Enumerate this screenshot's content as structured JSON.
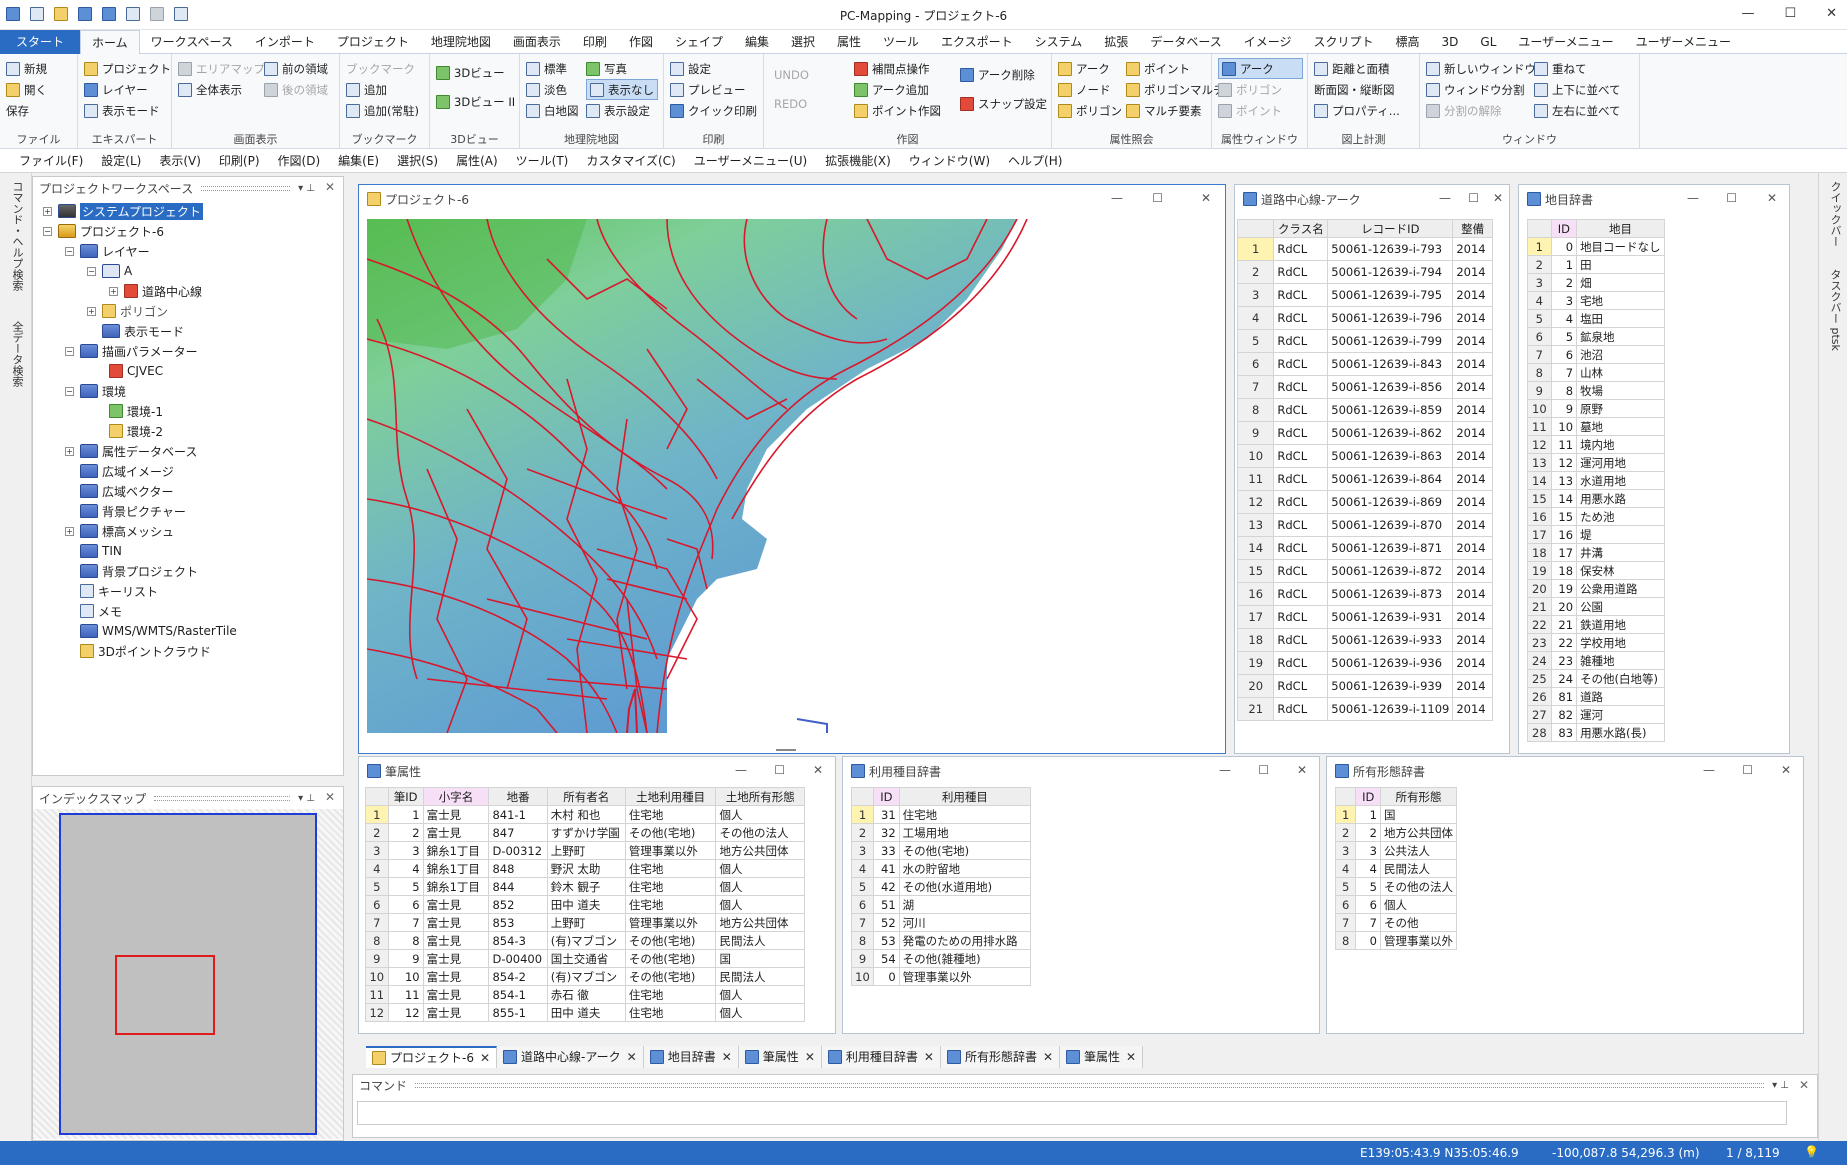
{
  "app": {
    "title": "PC-Mapping - プロジェクト-6"
  },
  "menu_tabs": [
    "スタート",
    "ホーム",
    "ワークスペース",
    "インポート",
    "プロジェクト",
    "地理院地図",
    "画面表示",
    "印刷",
    "作図",
    "シェイプ",
    "編集",
    "選択",
    "属性",
    "ツール",
    "エクスポート",
    "システム",
    "拡張",
    "データベース",
    "イメージ",
    "スクリプト",
    "標高",
    "3D",
    "GL",
    "ユーザーメニュー",
    "ユーザーメニュー"
  ],
  "ribbon": {
    "file": {
      "label": "ファイル",
      "items": [
        "新規",
        "開く",
        "保存"
      ]
    },
    "explorer": {
      "label": "エキスパート",
      "items": [
        "プロジェクト",
        "レイヤー",
        "表示モード"
      ]
    },
    "view": {
      "label": "画面表示",
      "items": [
        "エリアマップ",
        "全体表示",
        "前の領域",
        "後の領域"
      ]
    },
    "bookmark": {
      "label": "ブックマーク",
      "items": [
        "ブックマーク",
        "追加",
        "追加(常駐)"
      ]
    },
    "view3d": {
      "label": "3Dビュー",
      "items": [
        "3Dビュー",
        "3Dビュー II"
      ]
    },
    "gsi": {
      "label": "地理院地図",
      "items": [
        "標準",
        "淡色",
        "白地図",
        "写真",
        "表示なし",
        "表示設定"
      ]
    },
    "print": {
      "label": "印刷",
      "items": [
        "設定",
        "プレビュー",
        "クイック印刷"
      ]
    },
    "draw": {
      "label": "作図",
      "items": [
        "UNDO",
        "REDO",
        "補間点操作",
        "アーク追加",
        "ポイント作図",
        "アーク削除",
        "スナップ設定"
      ]
    },
    "attr_ref": {
      "label": "属性照会",
      "items": [
        "アーク",
        "ノード",
        "ポリゴン",
        "ポイント",
        "ポリゴンマルチ",
        "マルチ要素"
      ]
    },
    "attr_win": {
      "label": "属性ウィンドウ",
      "items": [
        "アーク",
        "ポリゴン",
        "ポイント"
      ]
    },
    "measure": {
      "label": "図上計測",
      "items": [
        "距離と面積",
        "断面図・縦断図",
        "プロパティ..."
      ]
    },
    "window": {
      "label": "ウィンドウ",
      "items": [
        "新しいウィンドウ",
        "ウィンドウ分割",
        "分割の解除",
        "重ねて",
        "上下に並べて",
        "左右に並べて"
      ]
    }
  },
  "command_menu": [
    "ファイル(F)",
    "設定(L)",
    "表示(V)",
    "印刷(P)",
    "作図(D)",
    "編集(E)",
    "選択(S)",
    "属性(A)",
    "ツール(T)",
    "カスタマイズ(C)",
    "ユーザーメニュー(U)",
    "拡張機能(X)",
    "ウィンドウ(W)",
    "ヘルプ(H)"
  ],
  "workspace": {
    "title": "プロジェクトワークスペース",
    "tree": [
      "システムプロジェクト",
      "プロジェクト-6",
      "レイヤー",
      "A",
      "道路中心線",
      "ポリゴン",
      "表示モード",
      "描画パラメーター",
      "CJVEC",
      "環境",
      "環境-1",
      "環境-2",
      "属性データベース",
      "広域イメージ",
      "広域ベクター",
      "背景ピクチャー",
      "標高メッシュ",
      "TIN",
      "背景プロジェクト",
      "キーリスト",
      "メモ",
      "WMS/WMTS/RasterTile",
      "3Dポイントクラウド"
    ]
  },
  "index_map": {
    "title": "インデックスマップ"
  },
  "left_vertical": [
    "コマンド・ヘルプ検索",
    "全データ検索"
  ],
  "right_vertical": [
    "クイックバー",
    "タスクバー ptsk"
  ],
  "map_window": {
    "title": "プロジェクト-6"
  },
  "road_table": {
    "title": "道路中心線-アーク",
    "headers": [
      "クラス名",
      "レコードID",
      "整備"
    ],
    "rows": [
      [
        "1",
        "RdCL",
        "50061-12639-i-793",
        "2014"
      ],
      [
        "2",
        "RdCL",
        "50061-12639-i-794",
        "2014"
      ],
      [
        "3",
        "RdCL",
        "50061-12639-i-795",
        "2014"
      ],
      [
        "4",
        "RdCL",
        "50061-12639-i-796",
        "2014"
      ],
      [
        "5",
        "RdCL",
        "50061-12639-i-799",
        "2014"
      ],
      [
        "6",
        "RdCL",
        "50061-12639-i-843",
        "2014"
      ],
      [
        "7",
        "RdCL",
        "50061-12639-i-856",
        "2014"
      ],
      [
        "8",
        "RdCL",
        "50061-12639-i-859",
        "2014"
      ],
      [
        "9",
        "RdCL",
        "50061-12639-i-862",
        "2014"
      ],
      [
        "10",
        "RdCL",
        "50061-12639-i-863",
        "2014"
      ],
      [
        "11",
        "RdCL",
        "50061-12639-i-864",
        "2014"
      ],
      [
        "12",
        "RdCL",
        "50061-12639-i-869",
        "2014"
      ],
      [
        "13",
        "RdCL",
        "50061-12639-i-870",
        "2014"
      ],
      [
        "14",
        "RdCL",
        "50061-12639-i-871",
        "2014"
      ],
      [
        "15",
        "RdCL",
        "50061-12639-i-872",
        "2014"
      ],
      [
        "16",
        "RdCL",
        "50061-12639-i-873",
        "2014"
      ],
      [
        "17",
        "RdCL",
        "50061-12639-i-931",
        "2014"
      ],
      [
        "18",
        "RdCL",
        "50061-12639-i-933",
        "2014"
      ],
      [
        "19",
        "RdCL",
        "50061-12639-i-936",
        "2014"
      ],
      [
        "20",
        "RdCL",
        "50061-12639-i-939",
        "2014"
      ],
      [
        "21",
        "RdCL",
        "50061-12639-i-1109",
        "2014"
      ]
    ]
  },
  "chimoku_table": {
    "title": "地目辞書",
    "headers": [
      "ID",
      "地目"
    ],
    "rows": [
      [
        "1",
        "0",
        "地目コードなし"
      ],
      [
        "2",
        "1",
        "田"
      ],
      [
        "3",
        "2",
        "畑"
      ],
      [
        "4",
        "3",
        "宅地"
      ],
      [
        "5",
        "4",
        "塩田"
      ],
      [
        "6",
        "5",
        "鉱泉地"
      ],
      [
        "7",
        "6",
        "池沼"
      ],
      [
        "8",
        "7",
        "山林"
      ],
      [
        "9",
        "8",
        "牧場"
      ],
      [
        "10",
        "9",
        "原野"
      ],
      [
        "11",
        "10",
        "墓地"
      ],
      [
        "12",
        "11",
        "境内地"
      ],
      [
        "13",
        "12",
        "運河用地"
      ],
      [
        "14",
        "13",
        "水道用地"
      ],
      [
        "15",
        "14",
        "用悪水路"
      ],
      [
        "16",
        "15",
        "ため池"
      ],
      [
        "17",
        "16",
        "堤"
      ],
      [
        "18",
        "17",
        "井溝"
      ],
      [
        "19",
        "18",
        "保安林"
      ],
      [
        "20",
        "19",
        "公衆用道路"
      ],
      [
        "21",
        "20",
        "公園"
      ],
      [
        "22",
        "21",
        "鉄道用地"
      ],
      [
        "23",
        "22",
        "学校用地"
      ],
      [
        "24",
        "23",
        "雑種地"
      ],
      [
        "25",
        "24",
        "その他(白地等)"
      ],
      [
        "26",
        "81",
        "道路"
      ],
      [
        "27",
        "82",
        "運河"
      ],
      [
        "28",
        "83",
        "用悪水路(長)"
      ]
    ]
  },
  "parcel_table": {
    "title": "筆属性",
    "headers": [
      "筆ID",
      "小字名",
      "地番",
      "所有者名",
      "土地利用種目",
      "土地所有形態"
    ],
    "rows": [
      [
        "1",
        "1",
        "富士見",
        "841-1",
        "木村 和也",
        "住宅地",
        "個人"
      ],
      [
        "2",
        "2",
        "富士見",
        "847",
        "すずかけ学園",
        "その他(宅地)",
        "その他の法人"
      ],
      [
        "3",
        "3",
        "錦糸1丁目",
        "D-00312",
        "上野町",
        "管理事業以外",
        "地方公共団体"
      ],
      [
        "4",
        "4",
        "錦糸1丁目",
        "848",
        "野沢 太助",
        "住宅地",
        "個人"
      ],
      [
        "5",
        "5",
        "錦糸1丁目",
        "844",
        "鈴木 観子",
        "住宅地",
        "個人"
      ],
      [
        "6",
        "6",
        "富士見",
        "852",
        "田中 道夫",
        "住宅地",
        "個人"
      ],
      [
        "7",
        "7",
        "富士見",
        "853",
        "上野町",
        "管理事業以外",
        "地方公共団体"
      ],
      [
        "8",
        "8",
        "富士見",
        "854-3",
        "(有)マブゴン",
        "その他(宅地)",
        "民間法人"
      ],
      [
        "9",
        "9",
        "富士見",
        "D-00400",
        "国土交通省",
        "その他(宅地)",
        "国"
      ],
      [
        "10",
        "10",
        "富士見",
        "854-2",
        "(有)マブゴン",
        "その他(宅地)",
        "民間法人"
      ],
      [
        "11",
        "11",
        "富士見",
        "854-1",
        "赤石 徹",
        "住宅地",
        "個人"
      ],
      [
        "12",
        "12",
        "富士見",
        "855-1",
        "田中 道夫",
        "住宅地",
        "個人"
      ]
    ]
  },
  "landuse_table": {
    "title": "利用種目辞書",
    "headers": [
      "ID",
      "利用種目"
    ],
    "rows": [
      [
        "1",
        "31",
        "住宅地"
      ],
      [
        "2",
        "32",
        "工場用地"
      ],
      [
        "3",
        "33",
        "その他(宅地)"
      ],
      [
        "4",
        "41",
        "水の貯留地"
      ],
      [
        "5",
        "42",
        "その他(水道用地)"
      ],
      [
        "6",
        "51",
        "湖"
      ],
      [
        "7",
        "52",
        "河川"
      ],
      [
        "8",
        "53",
        "発電のための用排水路"
      ],
      [
        "9",
        "54",
        "その他(雑種地)"
      ],
      [
        "10",
        "0",
        "管理事業以外"
      ]
    ]
  },
  "ownership_table": {
    "title": "所有形態辞書",
    "headers": [
      "ID",
      "所有形態"
    ],
    "rows": [
      [
        "1",
        "1",
        "国"
      ],
      [
        "2",
        "2",
        "地方公共団体"
      ],
      [
        "3",
        "3",
        "公共法人"
      ],
      [
        "4",
        "4",
        "民間法人"
      ],
      [
        "5",
        "5",
        "その他の法人"
      ],
      [
        "6",
        "6",
        "個人"
      ],
      [
        "7",
        "7",
        "その他"
      ],
      [
        "8",
        "0",
        "管理事業以外"
      ]
    ]
  },
  "doc_tabs": [
    "プロジェクト-6",
    "道路中心線-アーク",
    "地目辞書",
    "筆属性",
    "利用種目辞書",
    "所有形態辞書",
    "筆属性"
  ],
  "command_panel": {
    "title": "コマンド"
  },
  "status": {
    "coords_geo": "E139:05:43.9 N35:05:46.9",
    "coords_xy": "-100,087.8 54,296.3 (m)",
    "scale": "1 / 8,119"
  },
  "colors": {
    "accent": "#2a6cc4",
    "road": "#d8182c",
    "status_bar": "#2a6cc4"
  }
}
